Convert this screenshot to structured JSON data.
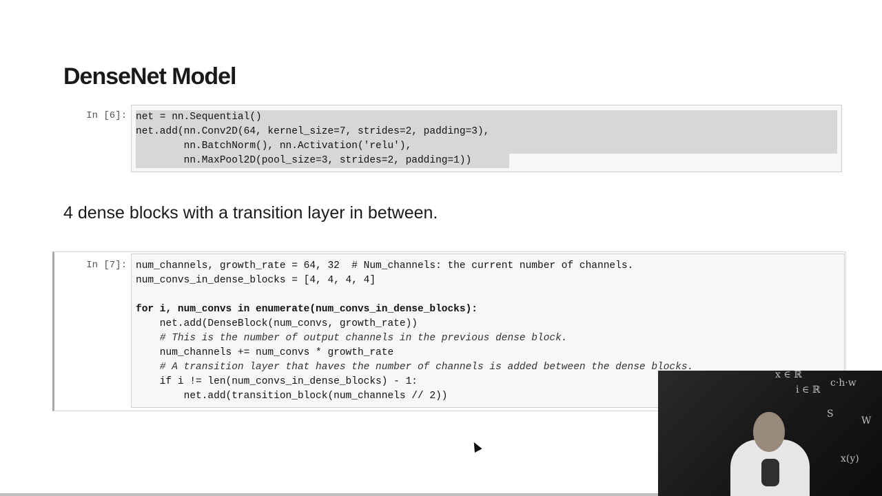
{
  "heading": "DenseNet Model",
  "subheading": "4 dense blocks with a transition layer in between.",
  "cell1": {
    "prompt": "In [6]:",
    "lines": [
      "net = nn.Sequential()",
      "net.add(nn.Conv2D(64, kernel_size=7, strides=2, padding=3),",
      "        nn.BatchNorm(), nn.Activation('relu'),",
      "        nn.MaxPool2D(pool_size=3, strides=2, padding=1))"
    ]
  },
  "cell2": {
    "prompt": "In [7]:",
    "lines": [
      "num_channels, growth_rate = 64, 32  # Num_channels: the current number of channels.",
      "num_convs_in_dense_blocks = [4, 4, 4, 4]",
      "",
      "for i, num_convs in enumerate(num_convs_in_dense_blocks):",
      "    net.add(DenseBlock(num_convs, growth_rate))",
      "    # This is the number of output channels in the previous dense block.",
      "    num_channels += num_convs * growth_rate",
      "    # A transition layer that haves the number of channels is added between the dense blocks.",
      "    if i != len(num_convs_in_dense_blocks) - 1:",
      "        net.add(transition_block(num_channels // 2))"
    ]
  },
  "webcam": {
    "board_text": [
      "x ∈ ℝ",
      "c·h·w",
      "i ∈ ℝ",
      "S",
      "W",
      "x(y)"
    ]
  },
  "colors": {
    "selection": "#d7d7d7",
    "cell_background": "#f7f7f7",
    "cell_border": "#cfcfcf",
    "webcam_background": "#1a1a1a"
  }
}
